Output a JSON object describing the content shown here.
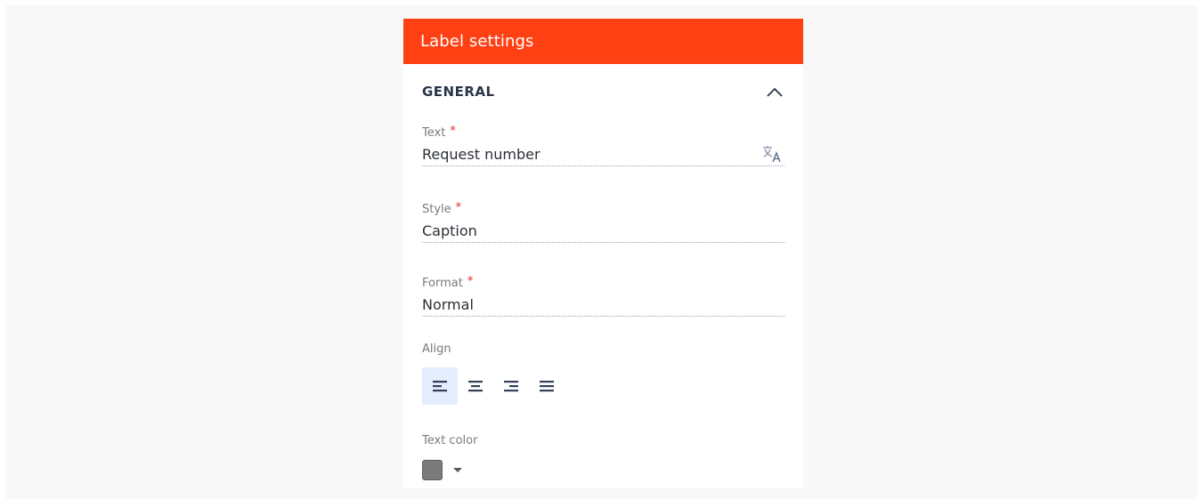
{
  "panel": {
    "title": "Label settings",
    "header_color": "#ff4013"
  },
  "section": {
    "title": "GENERAL",
    "toggle_icon": "chevron-up-icon"
  },
  "fields": {
    "text": {
      "label": "Text",
      "required_mark": "*",
      "value": "Request number",
      "icon": "translate-icon"
    },
    "style": {
      "label": "Style",
      "required_mark": "*",
      "value": "Caption"
    },
    "format": {
      "label": "Format",
      "required_mark": "*",
      "value": "Normal"
    }
  },
  "align": {
    "label": "Align",
    "options": [
      {
        "name": "align-left-icon",
        "selected": true
      },
      {
        "name": "align-center-icon",
        "selected": false
      },
      {
        "name": "align-right-icon",
        "selected": false
      },
      {
        "name": "align-justify-icon",
        "selected": false
      }
    ]
  },
  "text_color": {
    "label": "Text color",
    "value": "#7b7b7b",
    "dropdown_icon": "caret-down-icon"
  }
}
